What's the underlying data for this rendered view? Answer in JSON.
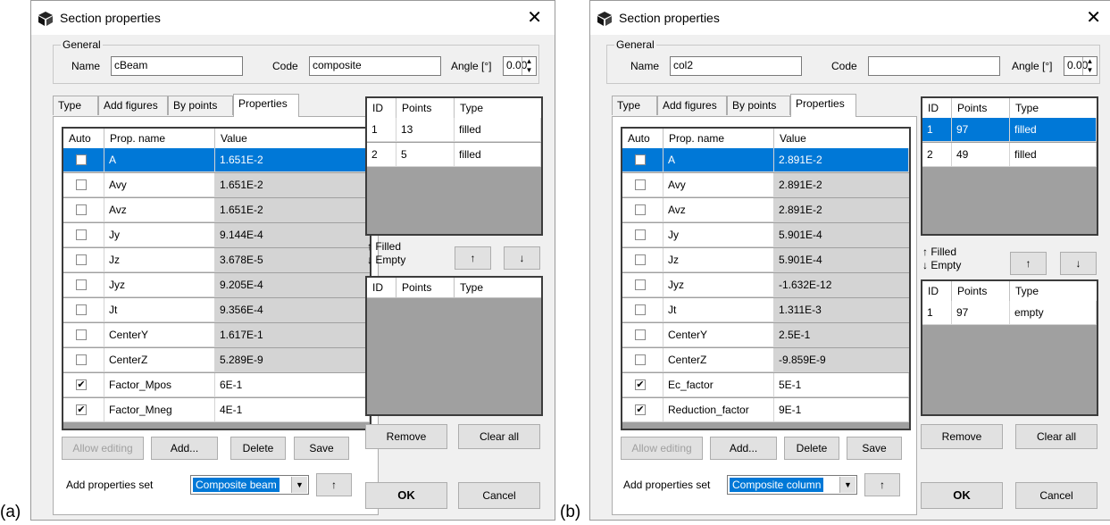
{
  "panels": [
    {
      "panel_label": "(a)",
      "title": "Section properties",
      "general": {
        "legend": "General",
        "name_label": "Name",
        "name_value": "cBeam",
        "code_label": "Code",
        "code_value": "composite",
        "angle_label": "Angle [°]",
        "angle_value": "0.00"
      },
      "tabs": [
        "Type",
        "Add figures",
        "By points",
        "Properties"
      ],
      "active_tab": "Properties",
      "prop_grid": {
        "headers": [
          "Auto",
          "Prop. name",
          "Value"
        ],
        "rows": [
          {
            "checked": false,
            "name": "A",
            "value": "1.651E-2",
            "selected": true
          },
          {
            "checked": false,
            "name": "Avy",
            "value": "1.651E-2"
          },
          {
            "checked": false,
            "name": "Avz",
            "value": "1.651E-2"
          },
          {
            "checked": false,
            "name": "Jy",
            "value": "9.144E-4"
          },
          {
            "checked": false,
            "name": "Jz",
            "value": "3.678E-5"
          },
          {
            "checked": false,
            "name": "Jyz",
            "value": "9.205E-4"
          },
          {
            "checked": false,
            "name": "Jt",
            "value": "9.356E-4"
          },
          {
            "checked": false,
            "name": "CenterY",
            "value": "1.617E-1"
          },
          {
            "checked": false,
            "name": "CenterZ",
            "value": "5.289E-9"
          },
          {
            "checked": true,
            "name": "Factor_Mpos",
            "value": "6E-1",
            "editable": true
          },
          {
            "checked": true,
            "name": "Factor_Mneg",
            "value": "4E-1",
            "editable": true
          }
        ]
      },
      "buttons": {
        "allow_editing": "Allow editing",
        "add": "Add...",
        "delete": "Delete",
        "save": "Save",
        "remove": "Remove",
        "clear_all": "Clear all",
        "ok": "OK",
        "cancel": "Cancel",
        "up": "↑",
        "down": "↓"
      },
      "add_set_label": "Add properties set",
      "add_set_value": "Composite beam",
      "filled_label": "↑ Filled",
      "empty_label": "↓ Empty",
      "filled_grid": {
        "headers": [
          "ID",
          "Points",
          "Type"
        ],
        "rows": [
          {
            "id": "1",
            "points": "13",
            "type": "filled",
            "selected": false
          },
          {
            "id": "2",
            "points": "5",
            "type": "filled",
            "selected": false
          }
        ]
      },
      "empty_grid": {
        "headers": [
          "ID",
          "Points",
          "Type"
        ],
        "rows": []
      }
    },
    {
      "panel_label": "(b)",
      "title": "Section properties",
      "general": {
        "legend": "General",
        "name_label": "Name",
        "name_value": "col2",
        "code_label": "Code",
        "code_value": "",
        "angle_label": "Angle [°]",
        "angle_value": "0.00"
      },
      "tabs": [
        "Type",
        "Add figures",
        "By points",
        "Properties"
      ],
      "active_tab": "Properties",
      "prop_grid": {
        "headers": [
          "Auto",
          "Prop. name",
          "Value"
        ],
        "rows": [
          {
            "checked": false,
            "name": "A",
            "value": "2.891E-2",
            "selected": true
          },
          {
            "checked": false,
            "name": "Avy",
            "value": "2.891E-2"
          },
          {
            "checked": false,
            "name": "Avz",
            "value": "2.891E-2"
          },
          {
            "checked": false,
            "name": "Jy",
            "value": "5.901E-4"
          },
          {
            "checked": false,
            "name": "Jz",
            "value": "5.901E-4"
          },
          {
            "checked": false,
            "name": "Jyz",
            "value": "-1.632E-12"
          },
          {
            "checked": false,
            "name": "Jt",
            "value": "1.311E-3"
          },
          {
            "checked": false,
            "name": "CenterY",
            "value": "2.5E-1"
          },
          {
            "checked": false,
            "name": "CenterZ",
            "value": "-9.859E-9"
          },
          {
            "checked": true,
            "name": "Ec_factor",
            "value": "5E-1",
            "editable": true
          },
          {
            "checked": true,
            "name": "Reduction_factor",
            "value": "9E-1",
            "editable": true
          }
        ]
      },
      "buttons": {
        "allow_editing": "Allow editing",
        "add": "Add...",
        "delete": "Delete",
        "save": "Save",
        "remove": "Remove",
        "clear_all": "Clear all",
        "ok": "OK",
        "cancel": "Cancel",
        "up": "↑",
        "down": "↓"
      },
      "add_set_label": "Add properties set",
      "add_set_value": "Composite column",
      "filled_label": "↑ Filled",
      "empty_label": "↓ Empty",
      "filled_grid": {
        "headers": [
          "ID",
          "Points",
          "Type"
        ],
        "rows": [
          {
            "id": "1",
            "points": "97",
            "type": "filled",
            "selected": true
          },
          {
            "id": "2",
            "points": "49",
            "type": "filled",
            "selected": false
          }
        ]
      },
      "empty_grid": {
        "headers": [
          "ID",
          "Points",
          "Type"
        ],
        "rows": [
          {
            "id": "1",
            "points": "97",
            "type": "empty",
            "selected": false
          }
        ]
      }
    }
  ],
  "colors": {
    "selection": "#0078d7",
    "grid_empty": "#a0a0a0",
    "readonly_cell": "#d4d4d4",
    "dialog_bg": "#f0f0f0"
  },
  "icons": {
    "title_icon": "cube-icon",
    "close": "close-icon",
    "dropdown": "chevron-down-icon"
  }
}
